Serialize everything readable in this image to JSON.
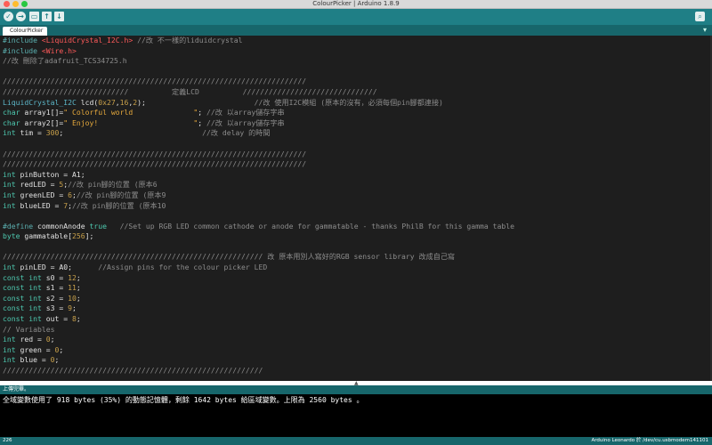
{
  "window": {
    "title": "ColourPicker | Arduino 1.8.9"
  },
  "toolbar": {
    "verify": "✓",
    "upload": "→",
    "new": "▭",
    "open": "↑",
    "save": "↓",
    "serial": "⌕"
  },
  "tab": {
    "label": "ColourPicker §",
    "menu": "▾"
  },
  "status": {
    "message": "上傳完畢。"
  },
  "console": {
    "line": "全域變數使用了 918 bytes (35%) 的動態記憶體，剩餘 1642 bytes 給區域變數。上限為 2560 bytes 。"
  },
  "footer": {
    "line": "226",
    "board": "Arduino Leonardo 於 /dev/cu.usbmodem141101"
  },
  "code": [
    [
      [
        "inc",
        "#include "
      ],
      [
        "hdr",
        "<LiquidCrystal_I2C.h>"
      ],
      [
        "cm",
        " //改 不一樣的liduidcrystal"
      ]
    ],
    [
      [
        "inc",
        "#include "
      ],
      [
        "hdr",
        "<Wire.h>"
      ]
    ],
    [
      [
        "cm",
        "//改 刪除了adafruit_TCS34725.h"
      ]
    ],
    [],
    [
      [
        "cm",
        "//////////////////////////////////////////////////////////////////////"
      ]
    ],
    [
      [
        "cm",
        "/////////////////////////////          定義LCD          ///////////////////////////////"
      ]
    ],
    [
      [
        "tp",
        "LiquidCrystal_I2C "
      ],
      [
        "tx",
        "lcd("
      ],
      [
        "num",
        "0x27"
      ],
      [
        "tx",
        ","
      ],
      [
        "num",
        "16"
      ],
      [
        "tx",
        ","
      ],
      [
        "num",
        "2"
      ],
      [
        "tx",
        ");"
      ],
      [
        "cm",
        "                         //改 使用I2C模組 (原本的沒有，必須每個pin腳都連接)"
      ]
    ],
    [
      [
        "kw",
        "char "
      ],
      [
        "tx",
        "array1[]="
      ],
      [
        "str",
        "\" Colorful world              \""
      ],
      [
        "tx",
        "; "
      ],
      [
        "cm",
        "//改 以array儲存字串"
      ]
    ],
    [
      [
        "kw",
        "char "
      ],
      [
        "tx",
        "array2[]="
      ],
      [
        "str",
        "\" Enjoy!                      \""
      ],
      [
        "tx",
        "; "
      ],
      [
        "cm",
        "//改 以array儲存字串"
      ]
    ],
    [
      [
        "kw",
        "int "
      ],
      [
        "tx",
        "tim = "
      ],
      [
        "num",
        "300"
      ],
      [
        "tx",
        ";"
      ],
      [
        "cm",
        "                                //改 delay 的時間"
      ]
    ],
    [],
    [
      [
        "cm",
        "//////////////////////////////////////////////////////////////////////"
      ]
    ],
    [
      [
        "cm",
        "//////////////////////////////////////////////////////////////////////"
      ]
    ],
    [
      [
        "kw",
        "int "
      ],
      [
        "tx",
        "pinButton = A1;"
      ]
    ],
    [
      [
        "kw",
        "int "
      ],
      [
        "tx",
        "redLED = "
      ],
      [
        "num",
        "5"
      ],
      [
        "tx",
        ";"
      ],
      [
        "cm",
        "//改 pin腳的位置 (原本6"
      ]
    ],
    [
      [
        "kw",
        "int "
      ],
      [
        "tx",
        "greenLED = "
      ],
      [
        "num",
        "6"
      ],
      [
        "tx",
        ";"
      ],
      [
        "cm",
        "//改 pin腳的位置 (原本9"
      ]
    ],
    [
      [
        "kw",
        "int "
      ],
      [
        "tx",
        "blueLED = "
      ],
      [
        "num",
        "7"
      ],
      [
        "tx",
        ";"
      ],
      [
        "cm",
        "//改 pin腳的位置 (原本10"
      ]
    ],
    [],
    [
      [
        "inc",
        "#define "
      ],
      [
        "tx",
        "commonAnode "
      ],
      [
        "kw",
        "true"
      ],
      [
        "cm",
        "   //Set up RGB LED common cathode or anode for gammatable - thanks PhilB for this gamma table"
      ]
    ],
    [
      [
        "kw",
        "byte "
      ],
      [
        "tx",
        "gammatable["
      ],
      [
        "num",
        "256"
      ],
      [
        "tx",
        "];"
      ]
    ],
    [],
    [
      [
        "cm",
        "//////////////////////////////////////////////////////////// 改 原本用別人寫好的RGB sensor library 改成自己寫"
      ]
    ],
    [
      [
        "kw",
        "int "
      ],
      [
        "tx",
        "pinLED = A0;"
      ],
      [
        "cm",
        "      //Assign pins for the colour picker LED"
      ]
    ],
    [
      [
        "kw",
        "const int "
      ],
      [
        "tx",
        "s0 = "
      ],
      [
        "num",
        "12"
      ],
      [
        "tx",
        ";"
      ]
    ],
    [
      [
        "kw",
        "const int "
      ],
      [
        "tx",
        "s1 = "
      ],
      [
        "num",
        "11"
      ],
      [
        "tx",
        ";"
      ]
    ],
    [
      [
        "kw",
        "const int "
      ],
      [
        "tx",
        "s2 = "
      ],
      [
        "num",
        "10"
      ],
      [
        "tx",
        ";"
      ]
    ],
    [
      [
        "kw",
        "const int "
      ],
      [
        "tx",
        "s3 = "
      ],
      [
        "num",
        "9"
      ],
      [
        "tx",
        ";"
      ]
    ],
    [
      [
        "kw",
        "const int "
      ],
      [
        "tx",
        "out = "
      ],
      [
        "num",
        "8"
      ],
      [
        "tx",
        ";"
      ]
    ],
    [
      [
        "cm",
        "// Variables"
      ]
    ],
    [
      [
        "kw",
        "int "
      ],
      [
        "tx",
        "red = "
      ],
      [
        "num",
        "0"
      ],
      [
        "tx",
        ";"
      ]
    ],
    [
      [
        "kw",
        "int "
      ],
      [
        "tx",
        "green = "
      ],
      [
        "num",
        "0"
      ],
      [
        "tx",
        ";"
      ]
    ],
    [
      [
        "kw",
        "int "
      ],
      [
        "tx",
        "blue = "
      ],
      [
        "num",
        "0"
      ],
      [
        "tx",
        ";"
      ]
    ],
    [
      [
        "cm",
        "////////////////////////////////////////////////////////////"
      ]
    ]
  ]
}
